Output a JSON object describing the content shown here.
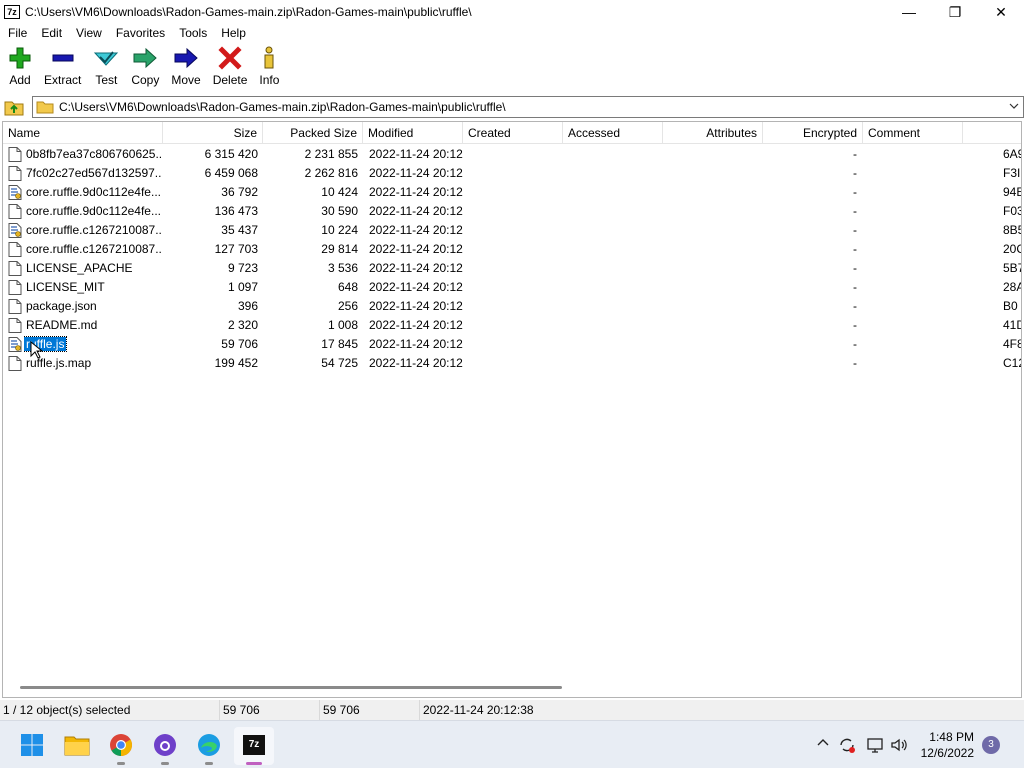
{
  "window": {
    "app_icon_text": "7z",
    "title": "C:\\Users\\VM6\\Downloads\\Radon-Games-main.zip\\Radon-Games-main\\public\\ruffle\\",
    "minimize_glyph": "—",
    "maximize_glyph": "❐",
    "close_glyph": "✕"
  },
  "menu": [
    "File",
    "Edit",
    "View",
    "Favorites",
    "Tools",
    "Help"
  ],
  "toolbar": {
    "add": "Add",
    "extract": "Extract",
    "test": "Test",
    "copy": "Copy",
    "move": "Move",
    "delete": "Delete",
    "info": "Info"
  },
  "address": {
    "path": "C:\\Users\\VM6\\Downloads\\Radon-Games-main.zip\\Radon-Games-main\\public\\ruffle\\"
  },
  "columns": [
    "Name",
    "Size",
    "Packed Size",
    "Modified",
    "Created",
    "Accessed",
    "Attributes",
    "Encrypted",
    "Comment"
  ],
  "files": [
    {
      "name": "0b8fb7ea37c806760625....",
      "size": "6 315 420",
      "packed": "2 231 855",
      "modified": "2022-11-24 20:12",
      "encrypted": "-",
      "crc": "6A9",
      "icon": "file-icon"
    },
    {
      "name": "7fc02c27ed567d132597....",
      "size": "6 459 068",
      "packed": "2 262 816",
      "modified": "2022-11-24 20:12",
      "encrypted": "-",
      "crc": "F3I",
      "icon": "file-icon"
    },
    {
      "name": "core.ruffle.9d0c112e4fe...",
      "size": "36 792",
      "packed": "10 424",
      "modified": "2022-11-24 20:12",
      "encrypted": "-",
      "crc": "94E",
      "icon": "script-file-icon"
    },
    {
      "name": "core.ruffle.9d0c112e4fe...",
      "size": "136 473",
      "packed": "30 590",
      "modified": "2022-11-24 20:12",
      "encrypted": "-",
      "crc": "F03",
      "icon": "file-icon"
    },
    {
      "name": "core.ruffle.c1267210087...",
      "size": "35 437",
      "packed": "10 224",
      "modified": "2022-11-24 20:12",
      "encrypted": "-",
      "crc": "8B5",
      "icon": "script-file-icon"
    },
    {
      "name": "core.ruffle.c1267210087...",
      "size": "127 703",
      "packed": "29 814",
      "modified": "2022-11-24 20:12",
      "encrypted": "-",
      "crc": "20C",
      "icon": "file-icon"
    },
    {
      "name": "LICENSE_APACHE",
      "size": "9 723",
      "packed": "3 536",
      "modified": "2022-11-24 20:12",
      "encrypted": "-",
      "crc": "5B7",
      "icon": "file-icon"
    },
    {
      "name": "LICENSE_MIT",
      "size": "1 097",
      "packed": "648",
      "modified": "2022-11-24 20:12",
      "encrypted": "-",
      "crc": "28A",
      "icon": "file-icon"
    },
    {
      "name": "package.json",
      "size": "396",
      "packed": "256",
      "modified": "2022-11-24 20:12",
      "encrypted": "-",
      "crc": "B0",
      "icon": "file-icon"
    },
    {
      "name": "README.md",
      "size": "2 320",
      "packed": "1 008",
      "modified": "2022-11-24 20:12",
      "encrypted": "-",
      "crc": "41D",
      "icon": "file-icon"
    },
    {
      "name": "ruffle.js",
      "size": "59 706",
      "packed": "17 845",
      "modified": "2022-11-24 20:12",
      "encrypted": "-",
      "crc": "4F8",
      "icon": "script-file-icon",
      "selected": true
    },
    {
      "name": "ruffle.js.map",
      "size": "199 452",
      "packed": "54 725",
      "modified": "2022-11-24 20:12",
      "encrypted": "-",
      "crc": "C12",
      "icon": "file-icon"
    }
  ],
  "status": {
    "selection": "1 / 12 object(s) selected",
    "size": "59 706",
    "packed": "59 706",
    "modified": "2022-11-24 20:12:38"
  },
  "taskbar": {
    "time": "1:48 PM",
    "date": "12/6/2022",
    "notifications": "3",
    "active_app_label": "7z"
  },
  "colors": {
    "selection": "#0078d7",
    "taskbar": "#e8edf4"
  }
}
